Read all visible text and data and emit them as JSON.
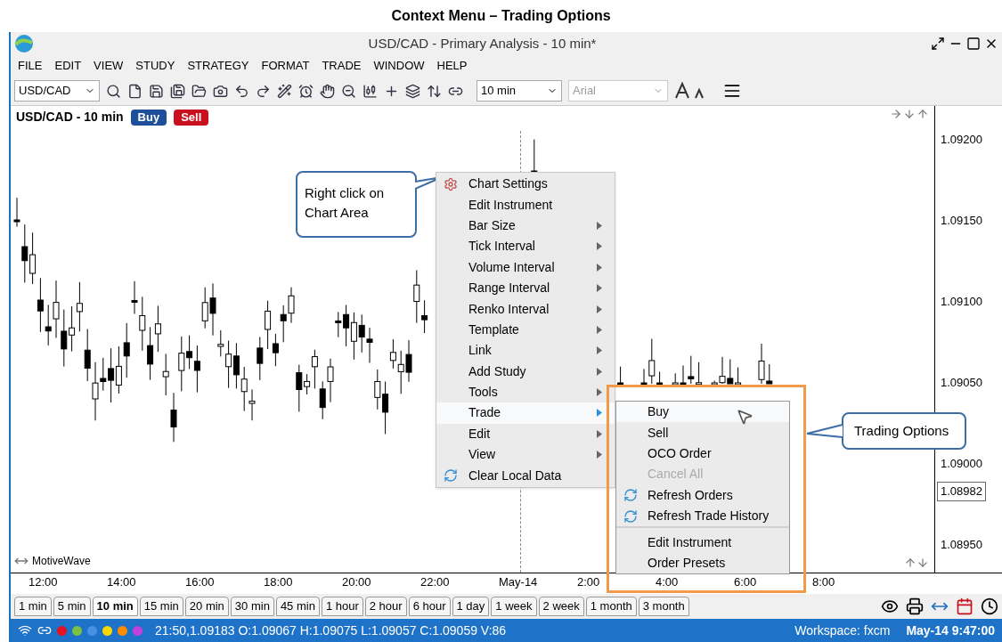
{
  "caption": "Context Menu – Trading Options",
  "window": {
    "title": "USD/CAD - Primary Analysis - 10 min*"
  },
  "menu_bar": [
    "FILE",
    "EDIT",
    "VIEW",
    "STUDY",
    "STRATEGY",
    "FORMAT",
    "TRADE",
    "WINDOW",
    "HELP"
  ],
  "toolbar": {
    "symbol": "USD/CAD",
    "bar_size": "10 min",
    "font": "Arial"
  },
  "chart": {
    "title": "USD/CAD - 10 min",
    "buy_label": "Buy",
    "sell_label": "Sell",
    "brand": "MotiveWave",
    "current_price": "1.08982",
    "price_ticks": [
      "1.09200",
      "1.09150",
      "1.09100",
      "1.09050",
      "1.09000",
      "1.08950"
    ],
    "time_ticks": [
      "12:00",
      "14:00",
      "16:00",
      "18:00",
      "20:00",
      "22:00",
      "May-14",
      "2:00",
      "4:00",
      "6:00",
      "8:00"
    ]
  },
  "context_menu": [
    {
      "kind": "settings",
      "label": "Chart Settings",
      "submenu": false,
      "selected": false
    },
    {
      "kind": "plain",
      "label": "Edit Instrument",
      "submenu": false,
      "selected": false
    },
    {
      "kind": "plain",
      "label": "Bar Size",
      "submenu": true,
      "selected": false
    },
    {
      "kind": "plain",
      "label": "Tick Interval",
      "submenu": true,
      "selected": false
    },
    {
      "kind": "plain",
      "label": "Volume Interval",
      "submenu": true,
      "selected": false
    },
    {
      "kind": "plain",
      "label": "Range Interval",
      "submenu": true,
      "selected": false
    },
    {
      "kind": "plain",
      "label": "Renko Interval",
      "submenu": true,
      "selected": false
    },
    {
      "kind": "plain",
      "label": "Template",
      "submenu": true,
      "selected": false
    },
    {
      "kind": "plain",
      "label": "Link",
      "submenu": true,
      "selected": false
    },
    {
      "kind": "plain",
      "label": "Add Study",
      "submenu": true,
      "selected": false
    },
    {
      "kind": "plain",
      "label": "Tools",
      "submenu": true,
      "selected": false
    },
    {
      "kind": "plain",
      "label": "Trade",
      "submenu": true,
      "selected": true
    },
    {
      "kind": "plain",
      "label": "Edit",
      "submenu": true,
      "selected": false
    },
    {
      "kind": "plain",
      "label": "View",
      "submenu": true,
      "selected": false
    },
    {
      "kind": "refresh",
      "label": "Clear Local Data",
      "submenu": false,
      "selected": false
    }
  ],
  "trade_submenu": [
    [
      {
        "kind": "plain",
        "label": "Buy",
        "selected": true,
        "disabled": false
      },
      {
        "kind": "plain",
        "label": "Sell",
        "selected": false,
        "disabled": false
      },
      {
        "kind": "plain",
        "label": "OCO Order",
        "selected": false,
        "disabled": false
      },
      {
        "kind": "plain",
        "label": "Cancel All",
        "selected": false,
        "disabled": true
      },
      {
        "kind": "refresh",
        "label": "Refresh Orders",
        "selected": false,
        "disabled": false
      },
      {
        "kind": "refresh",
        "label": "Refresh Trade History",
        "selected": false,
        "disabled": false
      }
    ],
    [
      {
        "kind": "plain",
        "label": "Edit Instrument",
        "selected": false,
        "disabled": false
      },
      {
        "kind": "plain",
        "label": "Order Presets",
        "selected": false,
        "disabled": false
      }
    ]
  ],
  "callouts": [
    "Right click on Chart Area",
    "Trading Options"
  ],
  "bar_size_tabs": [
    {
      "label": "1 min",
      "selected": false
    },
    {
      "label": "5 min",
      "selected": false
    },
    {
      "label": "10 min",
      "selected": true
    },
    {
      "label": "15 min",
      "selected": false
    },
    {
      "label": "20 min",
      "selected": false
    },
    {
      "label": "30 min",
      "selected": false
    },
    {
      "label": "45 min",
      "selected": false
    },
    {
      "label": "1 hour",
      "selected": false
    },
    {
      "label": "2 hour",
      "selected": false
    },
    {
      "label": "6 hour",
      "selected": false
    },
    {
      "label": "1 day",
      "selected": false
    },
    {
      "label": "1 week",
      "selected": false
    },
    {
      "label": "2 week",
      "selected": false
    },
    {
      "label": "1 month",
      "selected": false
    },
    {
      "label": "3 month",
      "selected": false
    }
  ],
  "status_bar": {
    "dots": [
      {
        "color": "#e81123"
      },
      {
        "color": "#7ac143"
      },
      {
        "color": "#4a90e2"
      },
      {
        "color": "#ffd700"
      },
      {
        "color": "#ff8c00"
      },
      {
        "color": "#c040e0"
      }
    ],
    "quote": "21:50,1.09183 O:1.09067 H:1.09075 L:1.09057 C:1.09059 V:86",
    "workspace": "Workspace: fxcm",
    "datetime": "May-14 9:47:00"
  }
}
